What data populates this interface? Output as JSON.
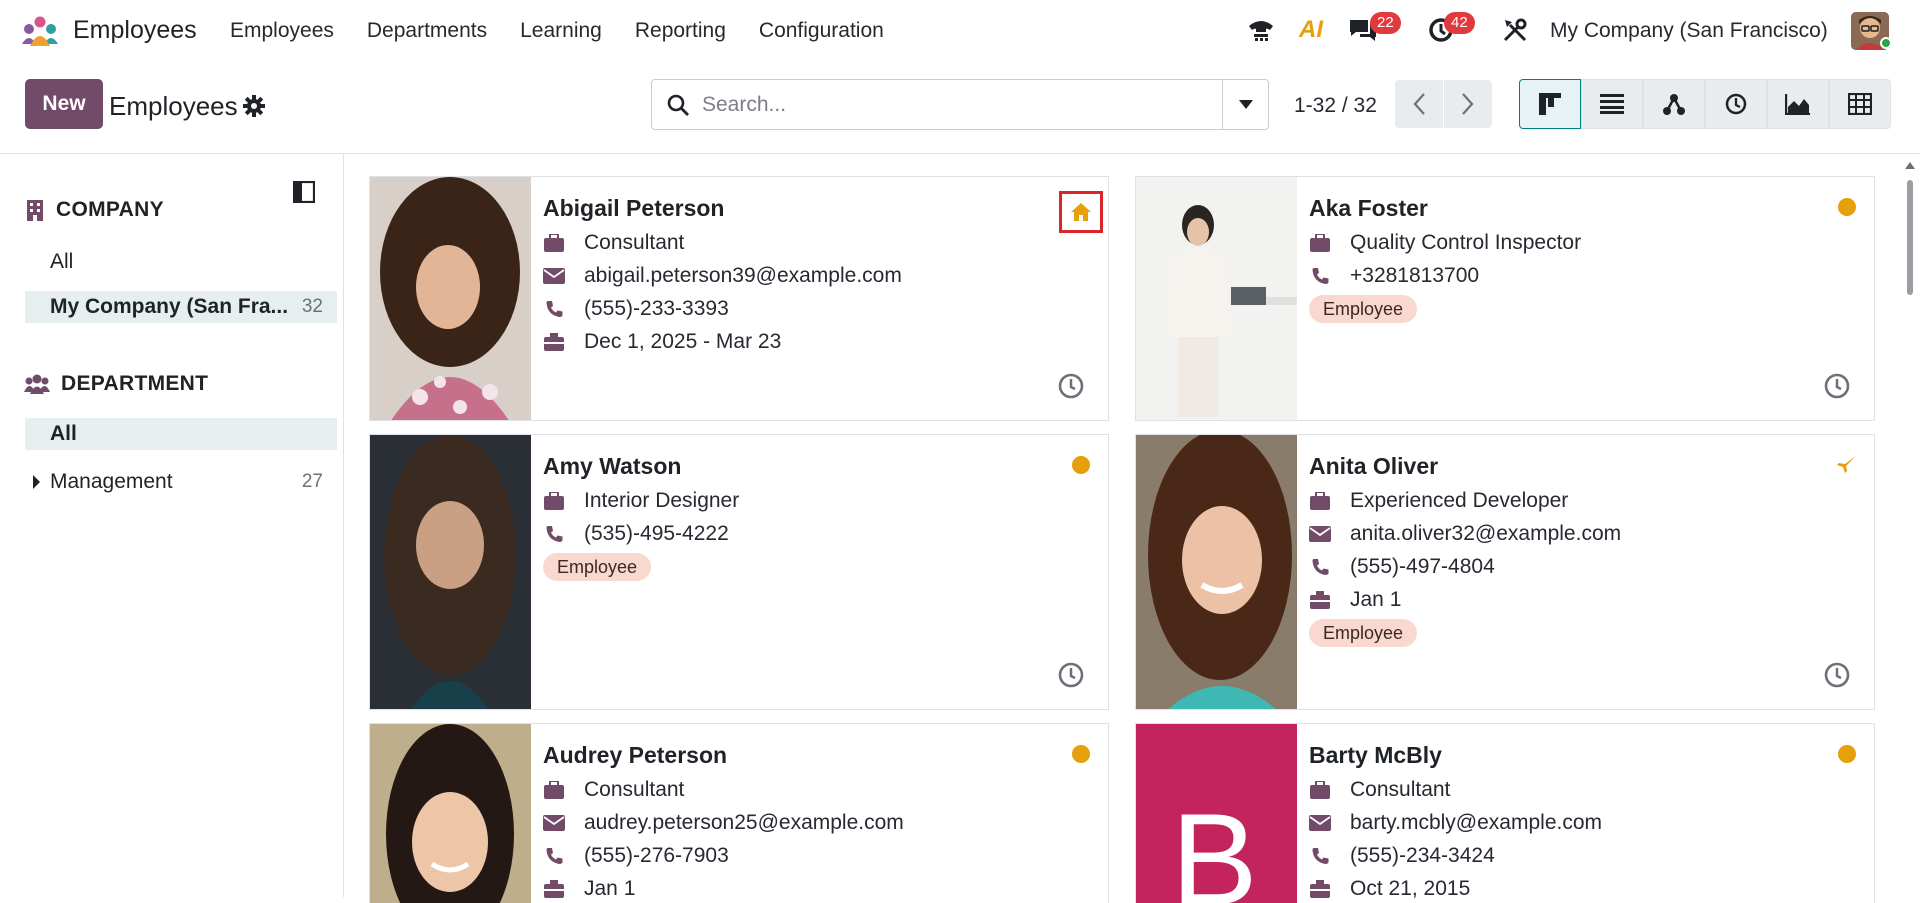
{
  "navbar": {
    "app_name": "Employees",
    "menu": [
      "Employees",
      "Departments",
      "Learning",
      "Reporting",
      "Configuration"
    ],
    "icons": [
      "phone-icon",
      "ai-icon",
      "chat-icon",
      "activity-icon",
      "tools-icon"
    ],
    "chat_count": "22",
    "activity_count": "42",
    "ai_label": "AI",
    "company": "My Company (San Francisco)"
  },
  "control_panel": {
    "new_label": "New",
    "title": "Employees",
    "search_placeholder": "Search...",
    "pager": "1-32 / 32",
    "views": [
      "kanban",
      "list",
      "hierarchy",
      "activity",
      "graph",
      "pivot"
    ],
    "active_view": "kanban"
  },
  "sidebar": {
    "company_header": "COMPANY",
    "company_items": [
      {
        "label": "All",
        "count": ""
      },
      {
        "label": "My Company (San Fra...",
        "count": "32"
      }
    ],
    "department_header": "DEPARTMENT",
    "department_items": [
      {
        "label": "All",
        "count": ""
      },
      {
        "label": "Management",
        "count": "27"
      }
    ]
  },
  "employees": [
    {
      "name": "Abigail Peterson",
      "job": "Consultant",
      "email": "abigail.peterson39@example.com",
      "phone": "(555)-233-3393",
      "dates": "Dec 1, 2025 - Mar 23",
      "tag": "",
      "status": "home-icon"
    },
    {
      "name": "Aka Foster",
      "job": "Quality Control Inspector",
      "email": "",
      "phone": "+3281813700",
      "dates": "",
      "tag": "Employee",
      "status": "present-dot"
    },
    {
      "name": "Amy Watson",
      "job": "Interior Designer",
      "email": "",
      "phone": "(535)-495-4222",
      "dates": "",
      "tag": "Employee",
      "status": "present-dot"
    },
    {
      "name": "Anita Oliver",
      "job": "Experienced Developer",
      "email": "anita.oliver32@example.com",
      "phone": "(555)-497-4804",
      "dates": "Jan 1",
      "tag": "Employee",
      "status": "plane-icon"
    },
    {
      "name": "Audrey Peterson",
      "job": "Consultant",
      "email": "audrey.peterson25@example.com",
      "phone": "(555)-276-7903",
      "dates": "Jan 1",
      "tag": "",
      "status": "present-dot"
    },
    {
      "name": "Barty McBly",
      "job": "Consultant",
      "email": "barty.mcbly@example.com",
      "phone": "(555)-234-3424",
      "dates": "Oct 21, 2015",
      "tag": "",
      "status": "present-dot",
      "initial": "B"
    }
  ],
  "colors": {
    "brand": "#714b67",
    "accent_teal": "#017e84",
    "status_orange": "#e6a00b",
    "tag_bg": "#f9d8cf",
    "badge_red": "#e03a3e",
    "initial_bg": "#c4245d"
  }
}
